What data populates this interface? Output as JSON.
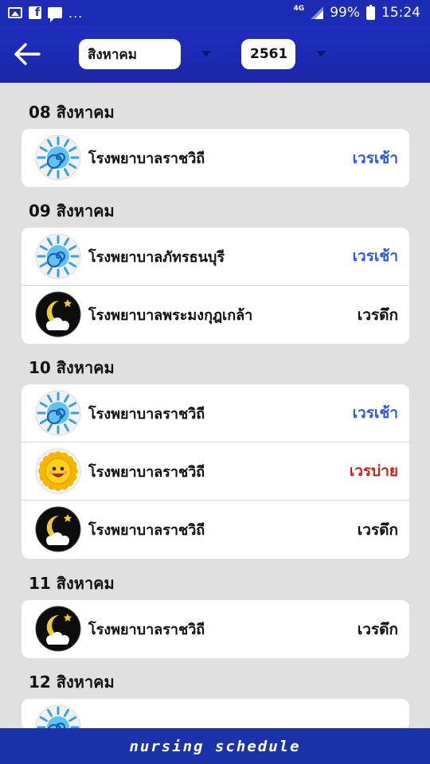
{
  "status_bar": {
    "left_icons": [
      "image-icon",
      "facebook-icon",
      "message-icon"
    ],
    "dots": "...",
    "network": "4G",
    "battery": "99%",
    "time": "15:24"
  },
  "header": {
    "back_icon": "arrow-left-icon",
    "month": "สิงหาคม",
    "year": "2561"
  },
  "days": [
    {
      "date": "08 สิงหาคม",
      "entries": [
        {
          "icon": "morning",
          "hospital": "โรงพยาบาลราชวิถี",
          "shift": "เวรเช้า"
        }
      ]
    },
    {
      "date": "09 สิงหาคม",
      "entries": [
        {
          "icon": "morning",
          "hospital": "โรงพยาบาลภัทรธนบุรี",
          "shift": "เวรเช้า"
        },
        {
          "icon": "night",
          "hospital": "โรงพยาบาลพระมงกุฎเกล้า",
          "shift": "เวรดึก"
        }
      ]
    },
    {
      "date": "10 สิงหาคม",
      "entries": [
        {
          "icon": "morning",
          "hospital": "โรงพยาบาลราชวิถี",
          "shift": "เวรเช้า"
        },
        {
          "icon": "afternoon",
          "hospital": "โรงพยาบาลราชวิถี",
          "shift": "เวรบ่าย"
        },
        {
          "icon": "night",
          "hospital": "โรงพยาบาลราชวิถี",
          "shift": "เวรดึก"
        }
      ]
    },
    {
      "date": "11 สิงหาคม",
      "entries": [
        {
          "icon": "night",
          "hospital": "โรงพยาบาลราชวิถี",
          "shift": "เวรดึก"
        }
      ]
    },
    {
      "date": "12 สิงหาคม",
      "entries": []
    }
  ],
  "colors": {
    "header_blue": "#1c2cb5",
    "morning": "#2f58d8",
    "afternoon": "#c8231b",
    "night": "#111111"
  },
  "footer": {
    "label": "nursing schedule"
  }
}
